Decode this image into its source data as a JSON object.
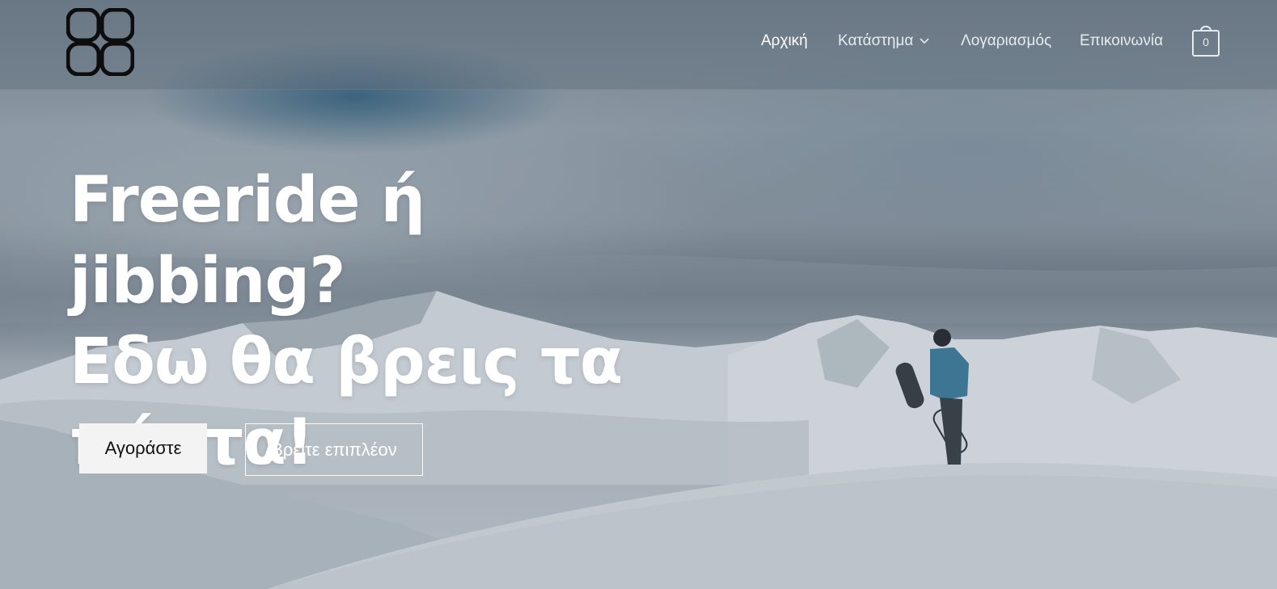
{
  "header": {
    "logo_icon": "four-rounded-squares-logo",
    "nav": [
      {
        "label": "Αρχική",
        "active": true
      },
      {
        "label": "Κατάστημα",
        "has_dropdown": true
      },
      {
        "label": "Λογαριασμός"
      },
      {
        "label": "Επικοινωνία"
      }
    ],
    "cart": {
      "icon": "shopping-bag-icon",
      "count": "0"
    }
  },
  "hero": {
    "headline_line1": "Freeride ή jibbing?",
    "headline_line2": "Εδω θα βρεις τα",
    "headline_line3": "πάντα!",
    "primary_button": "Αγοράστε",
    "secondary_button": "Βρείτε επιπλέον"
  },
  "colors": {
    "header_bg": "#5f6e7d",
    "text_light": "#ffffff",
    "button_bg": "#f3f3f3"
  }
}
